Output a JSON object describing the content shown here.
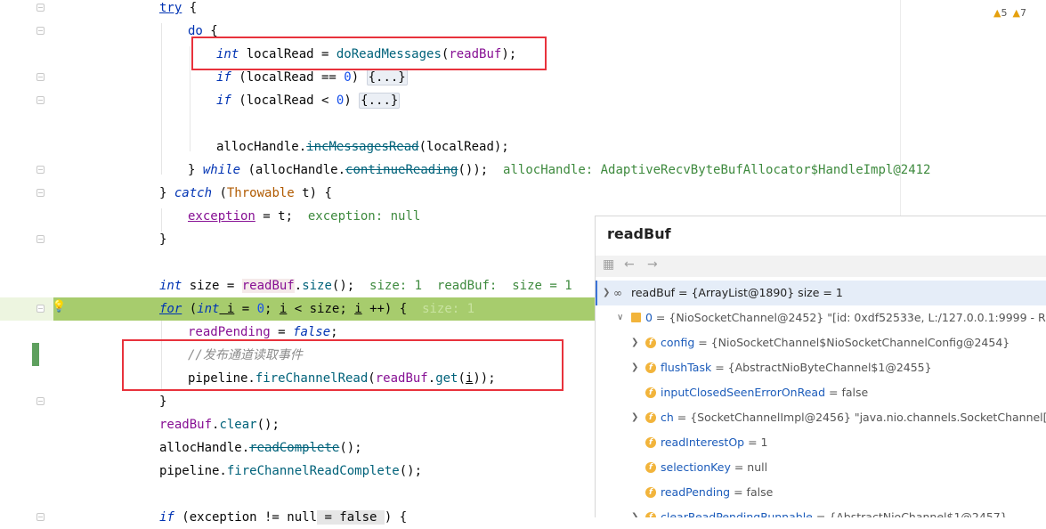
{
  "editor": {
    "lines": {
      "l1_try": "try",
      "l1_brace": " {",
      "l2_do": "do",
      "l2_brace": " {",
      "l3_int": "int",
      "l3_var": " localRead = ",
      "l3_meth": "doReadMessages",
      "l3_arg": "readBuf",
      "l3_end": ");",
      "l4_if": "if",
      "l4_cond": " (localRead == ",
      "l4_num": "0",
      "l4_end": ") ",
      "l4_fold": "{...}",
      "l5_if": "if",
      "l5_cond": " (localRead < ",
      "l5_num": "0",
      "l5_end": ") ",
      "l5_fold": "{...}",
      "l7_obj": "allocHandle.",
      "l7_meth": "incMessagesRead",
      "l7_end": "(localRead);",
      "l8_close": "} ",
      "l8_while": "while",
      "l8_open": " (allocHandle.",
      "l8_meth": "continueReading",
      "l8_end": "());",
      "l8_inlay": "  allocHandle: AdaptiveRecvByteBufAllocator$HandleImpl@2412",
      "l9_close": "} ",
      "l9_catch": "catch",
      "l9_open": " (",
      "l9_type": "Throwable",
      "l9_end": " t) {",
      "l10_field": "exception",
      "l10_end": " = t;",
      "l10_inlay": "  exception: null",
      "l11_close": "}",
      "l13_int": "int",
      "l13_var": " size = ",
      "l13_field": "readBuf",
      "l13_dot": ".",
      "l13_meth": "size",
      "l13_end": "();",
      "l13_inlay": "  size: 1  readBuf:  size = 1",
      "l14_for": "for",
      "l14_open": " (",
      "l14_int": "int",
      "l14_i": " i",
      "l14_eq": " = ",
      "l14_num": "0",
      "l14_semi": "; ",
      "l14_i2": "i",
      "l14_lt": " < size; ",
      "l14_i3": "i",
      "l14_inc": " ++) {",
      "l14_inlay": "  size: 1",
      "l15_field": "readPending",
      "l15_eq": " = ",
      "l15_false": "false",
      "l15_end": ";",
      "l16_comment": "//发布通道读取事件",
      "l17_obj": "pipeline.",
      "l17_meth": "fireChannelRead",
      "l17_open": "(",
      "l17_field": "readBuf",
      "l17_dot": ".",
      "l17_get": "get",
      "l17_i": "i",
      "l17_end": "));",
      "l18_close": "}",
      "l19_field": "readBuf",
      "l19_dot": ".",
      "l19_meth": "clear",
      "l19_end": "();",
      "l20_obj": "allocHandle.",
      "l20_meth": "readComplete",
      "l20_end": "();",
      "l21_obj": "pipeline.",
      "l21_meth": "fireChannelReadComplete",
      "l21_end": "();",
      "l23_if": "if",
      "l23_rest": " (exception != null",
      "l23_inlay": " = false ",
      "l23_end": ") {"
    }
  },
  "inspections": {
    "warnings": "5",
    "weak_warnings": "7"
  },
  "popup": {
    "title": "readBuf",
    "root": "readBuf = {ArrayList@1890}  size = 1",
    "item0_name": "0",
    "item0_val": " = {NioSocketChannel@2452} \"[id: 0xdf52533e, L:/127.0.0.1:9999 - R:/127.0.0.",
    "fields": [
      {
        "name": "config",
        "value": " = {NioSocketChannel$NioSocketChannelConfig@2454}",
        "expandable": true
      },
      {
        "name": "flushTask",
        "value": " = {AbstractNioByteChannel$1@2455}",
        "expandable": true
      },
      {
        "name": "inputClosedSeenErrorOnRead",
        "value": " = false",
        "expandable": false
      },
      {
        "name": "ch",
        "value": " = {SocketChannelImpl@2456} \"java.nio.channels.SocketChannel[connecte",
        "expandable": true
      },
      {
        "name": "readInterestOp",
        "value": " = 1",
        "expandable": false
      },
      {
        "name": "selectionKey",
        "value": " = null",
        "expandable": false
      },
      {
        "name": "readPending",
        "value": " = false",
        "expandable": false
      },
      {
        "name": "clearReadPendingRunnable",
        "value": " = {AbstractNioChannel$1@2457}",
        "expandable": true
      }
    ]
  },
  "colors": {
    "current_line": "#a7cc6d",
    "keyword": "#0033b3",
    "field": "#871094",
    "method": "#00627a",
    "number": "#1750eb",
    "inlay": "#3e8a3e",
    "red_box": "#e8323c"
  }
}
